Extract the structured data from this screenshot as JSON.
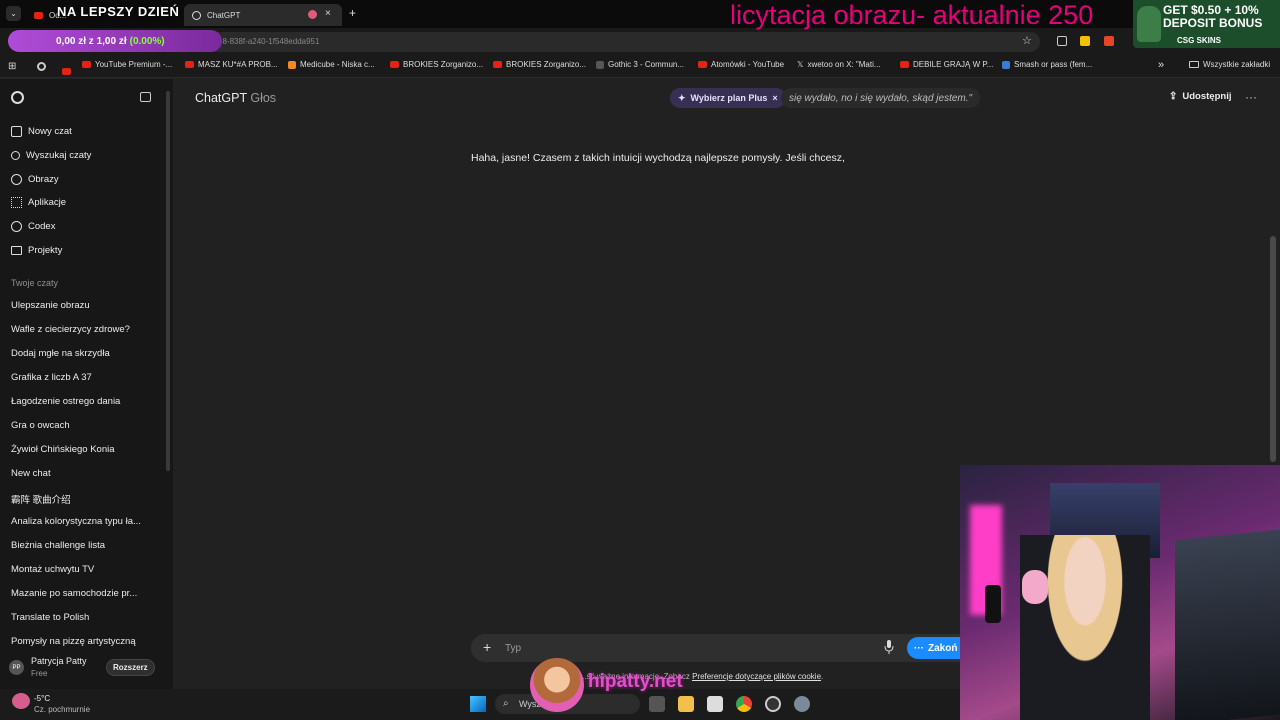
{
  "browser": {
    "tabs": [
      {
        "label": "Od...",
        "active": false
      },
      {
        "label": "ChatGPT",
        "active": true
      }
    ],
    "new_tab_label": "+",
    "url": "...e-8f7F-d1...e8-838f-a240-1f548edda951",
    "bookmarks": [
      {
        "label": "YouTube Premium -...",
        "icon": "youtube-icon"
      },
      {
        "label": "MASZ KU*#A PROB...",
        "icon": "youtube-icon"
      },
      {
        "label": "Medicube - Niska c...",
        "icon": "site-icon"
      },
      {
        "label": "BROKIES Zorganizo...",
        "icon": "youtube-icon"
      },
      {
        "label": "BROKIES Zorganizo...",
        "icon": "youtube-icon"
      },
      {
        "label": "Gothic 3 - Commun...",
        "icon": "site-icon"
      },
      {
        "label": "Atomówki - YouTube",
        "icon": "youtube-icon"
      },
      {
        "label": "xwetoo on X: \"Mati...",
        "icon": "x-icon"
      },
      {
        "label": "DEBILE GRAJĄ W P...",
        "icon": "youtube-icon"
      },
      {
        "label": "Smash or pass (fem...",
        "icon": "site-icon"
      }
    ],
    "all_bookmarks_label": "Wszystkie zakładki"
  },
  "overlay": {
    "title": "NA LEPSZY DZIEŃ",
    "donation_amount": "0,00 zł z 1,00 zł",
    "donation_percent": "(0.00%)",
    "auction_text": "licytacja obrazu-  aktualnie 250",
    "banner_line1": "GET $0.50 + 10%",
    "banner_line2": "DEPOSIT BONUS",
    "banner_brand": "CSG SKINS",
    "logo_text": "hipatty.net"
  },
  "sidebar": {
    "items": [
      {
        "label": "Nowy czat",
        "icon": "edit-icon"
      },
      {
        "label": "Wyszukaj czaty",
        "icon": "search-icon"
      },
      {
        "label": "Obrazy",
        "icon": "image-icon"
      },
      {
        "label": "Aplikacje",
        "icon": "apps-icon"
      },
      {
        "label": "Codex",
        "icon": "code-icon"
      },
      {
        "label": "Projekty",
        "icon": "folder-icon"
      }
    ],
    "section_label": "Twoje czaty",
    "chats": [
      "Ulepszanie obrazu",
      "Wafle z ciecierzycy zdrowe?",
      "Dodaj mgłe na skrzydła",
      "Grafika z liczb A 37",
      "Łagodzenie ostrego dania",
      "Gra o owcach",
      "Żywioł Chińskiego Konia",
      "New chat",
      "霸阵 歌曲介绍",
      "Analiza kolorystyczna typu ła...",
      "Bieżnia challenge lista",
      "Montaż uchwytu TV",
      "Mazanie po samochodzie pr...",
      "Translate to Polish",
      "Pomysły na pizzę artystyczną"
    ],
    "user": {
      "initials": "PP",
      "name": "Patrycja Patty",
      "plan": "Free",
      "upgrade_label": "Rozszerz"
    }
  },
  "header": {
    "title": "ChatGPT",
    "subtitle": "Głos",
    "plan_pill": "Wybierz plan Plus",
    "plan_close": "×",
    "caption": "się wydało, no i się wydało, skąd jestem.\"",
    "share_label": "Udostępnij",
    "more": "···"
  },
  "conversation": {
    "message": "Haha, jasne! Czasem z takich intuicji wychodzą najlepsze pomysły. Jeśli chcesz,"
  },
  "composer": {
    "placeholder": "Typ",
    "end_label": "Zakoń",
    "disclaimer_prefix": "...ść ważne informacje. Zobacz",
    "disclaimer_link": "Preferencje dotyczące plików cookie",
    "disclaimer_suffix": "."
  },
  "taskbar": {
    "temperature": "-5°C",
    "weather": "Cz. pochmurnie",
    "search": "Wysz"
  },
  "colors": {
    "background": "#212121",
    "sidebar": "#171717",
    "accent": "#1a8cff",
    "overlay_pink": "#e6007e"
  }
}
